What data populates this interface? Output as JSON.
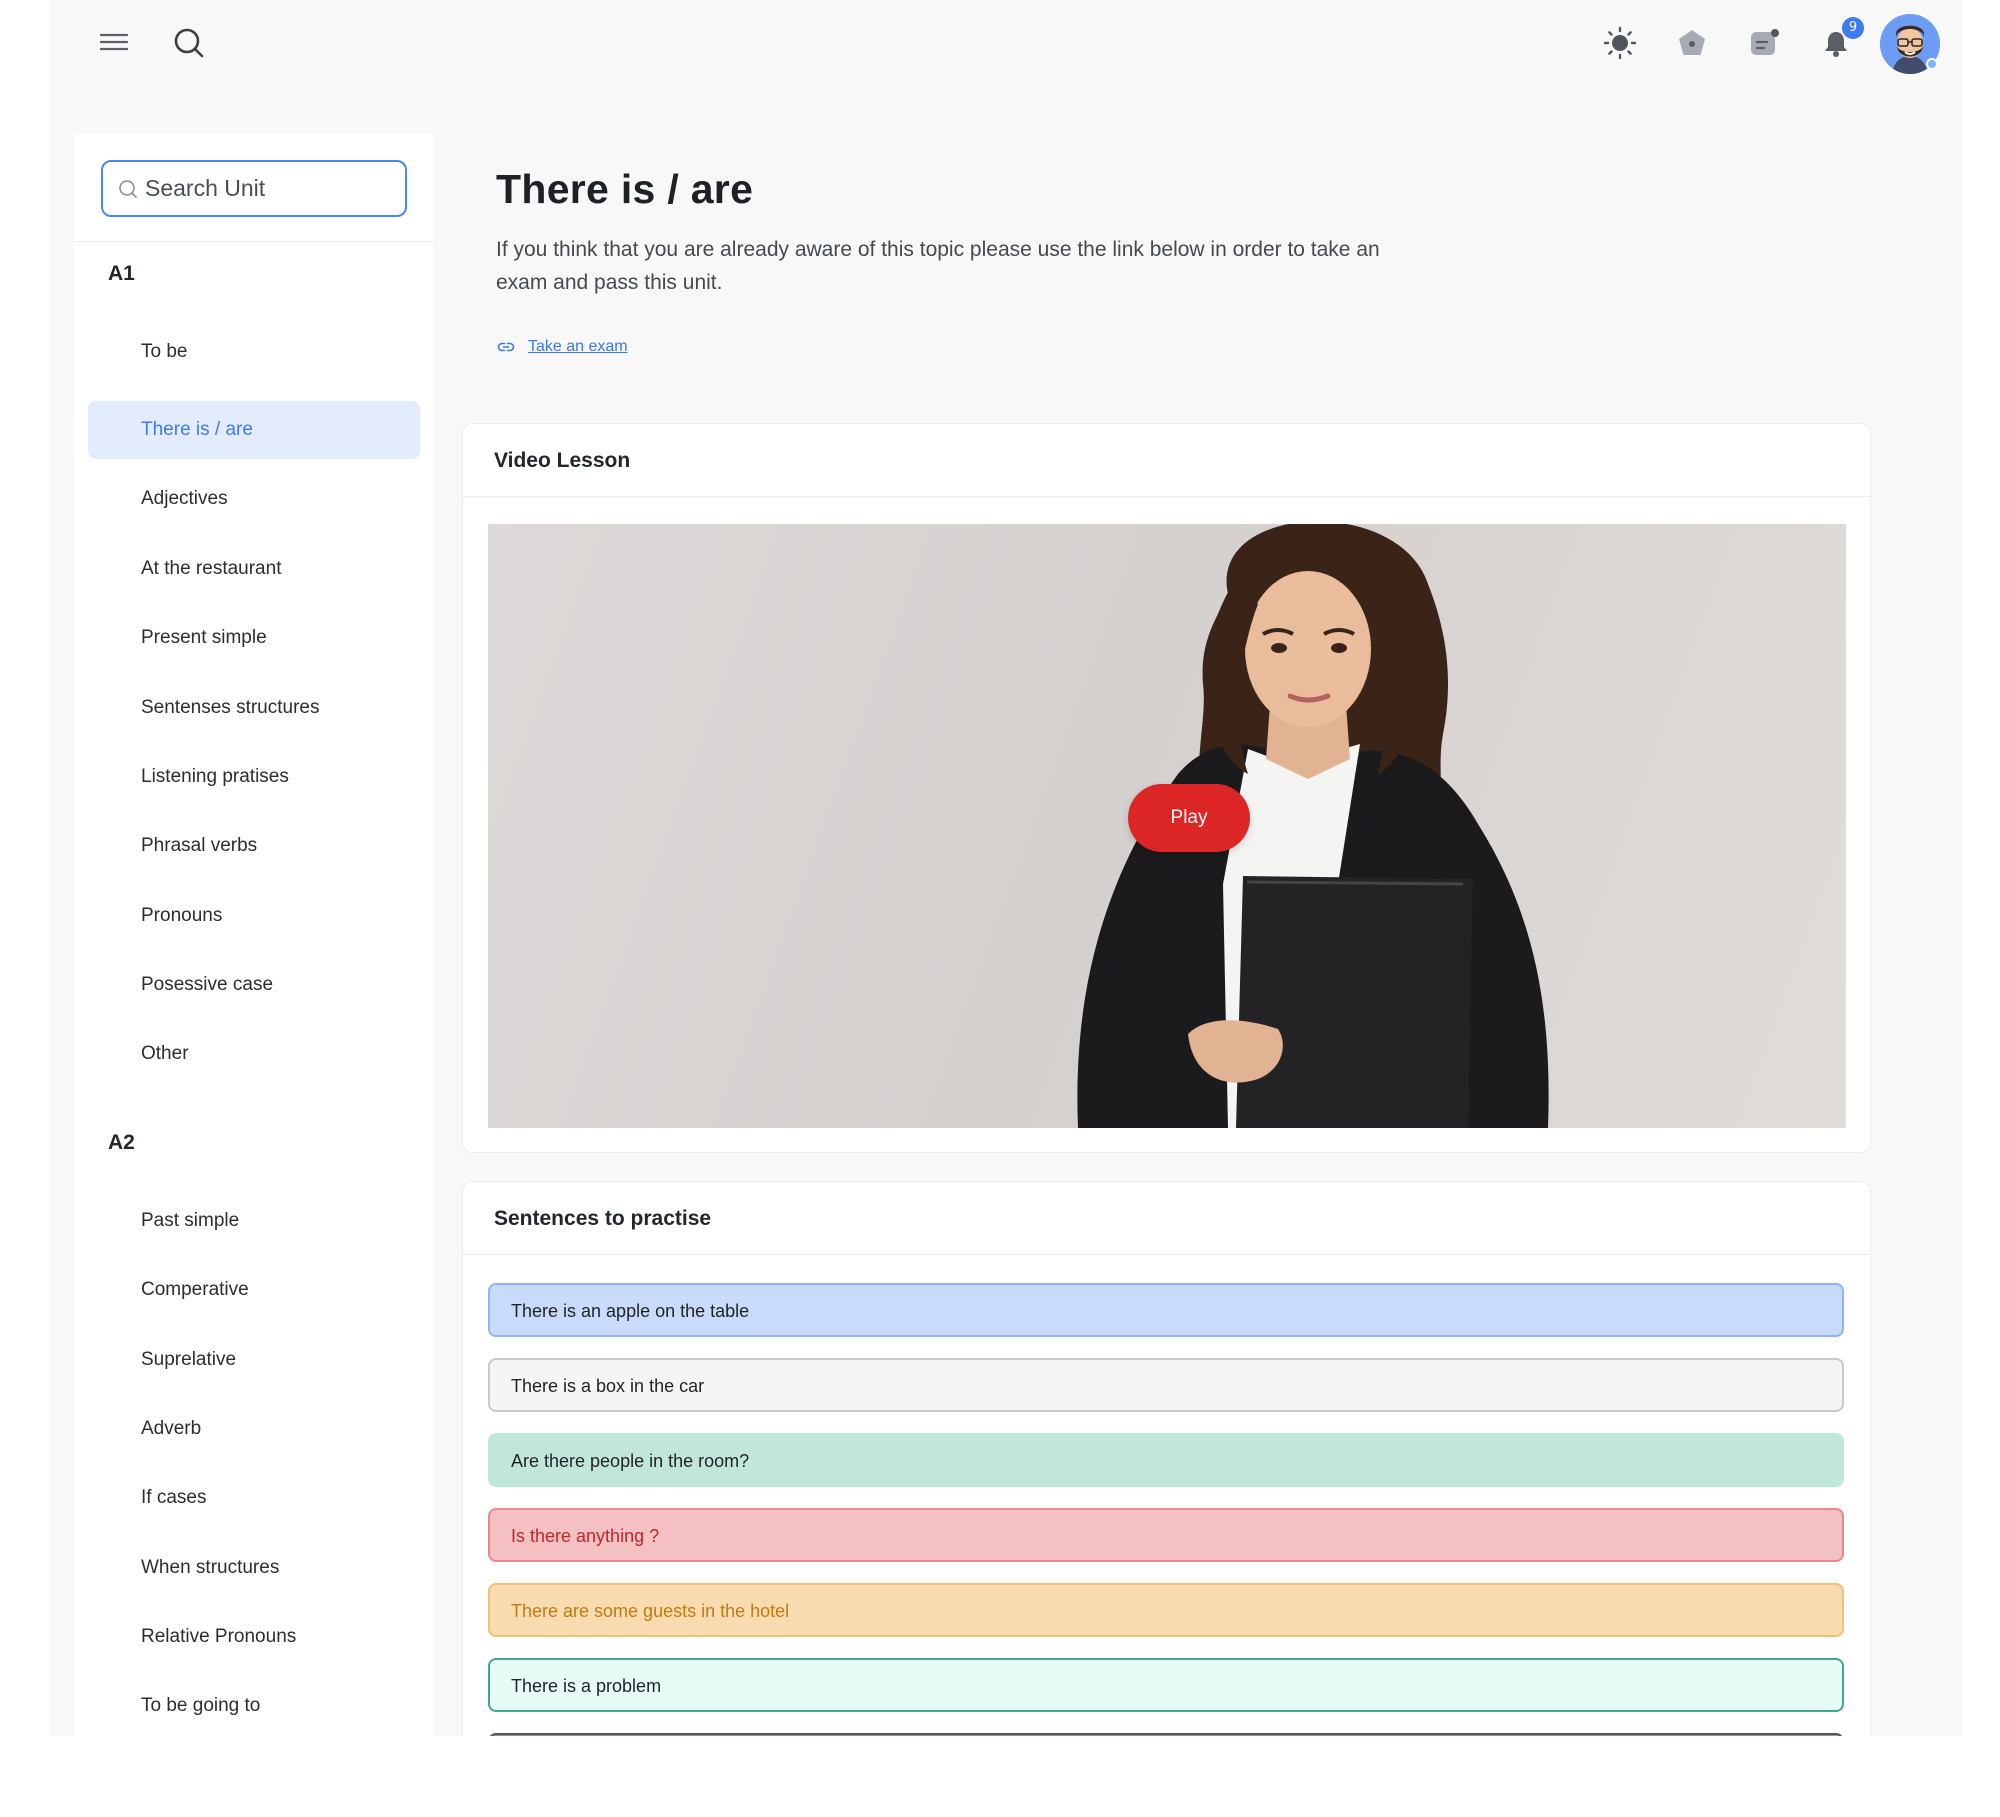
{
  "topbar": {
    "icons": [
      "menu-icon",
      "search-icon",
      "sun-icon",
      "pentagon-icon",
      "chat-icon",
      "bell-icon"
    ],
    "notification_count": "9"
  },
  "sidebar": {
    "search_placeholder": "Search Unit",
    "groups": [
      {
        "title": "A1",
        "items": [
          "To be",
          "There is / are",
          "Adjectives",
          "At the restaurant",
          "Present simple",
          "Sentenses structures",
          "Listening pratises",
          "Phrasal verbs",
          "Pronouns",
          "Posessive case",
          "Other"
        ]
      },
      {
        "title": "A2",
        "items": [
          "Past simple",
          "Comperative",
          "Suprelative",
          "Adverb",
          "If cases",
          "When structures",
          "Relative Pronouns",
          "To be going to"
        ]
      }
    ],
    "active_item": "There is / are"
  },
  "main": {
    "title": "There is / are",
    "description": "If you think that you are already aware of this topic please use the link below in order to take an exam and pass this unit.",
    "exam_link": "Take an exam",
    "video_card": {
      "title": "Video Lesson",
      "play_label": "Play"
    },
    "sentences_card": {
      "title": "Sentences to practise",
      "sentences": [
        {
          "text": "There is an apple on the table",
          "bg": "#c8dbfb",
          "border": "#8fb3f3",
          "color": "#1f2328"
        },
        {
          "text": "There is a box in the car",
          "bg": "#f5f5f5",
          "border": "#c9c9c9",
          "color": "#1f2328"
        },
        {
          "text": "Are there people in the room?",
          "bg": "#c1e6da",
          "border": "#c1e6da",
          "color": "#1f2328"
        },
        {
          "text": "Is there anything ?",
          "bg": "#f4c0c2",
          "border": "#e48a8e",
          "color": "#c0262c"
        },
        {
          "text": "There are some guests in the hotel",
          "bg": "#f8dcb0",
          "border": "#f0bf79",
          "color": "#c07a12"
        },
        {
          "text": "There is a problem",
          "bg": "#e6fcf5",
          "border": "#3fa98e",
          "color": "#1f2328"
        },
        {
          "text": "",
          "bg": "#8f929b",
          "border": "#55585f",
          "color": "#ffffff"
        }
      ]
    }
  },
  "colors": {
    "accent": "#3f7be9",
    "play": "#dc2626"
  }
}
